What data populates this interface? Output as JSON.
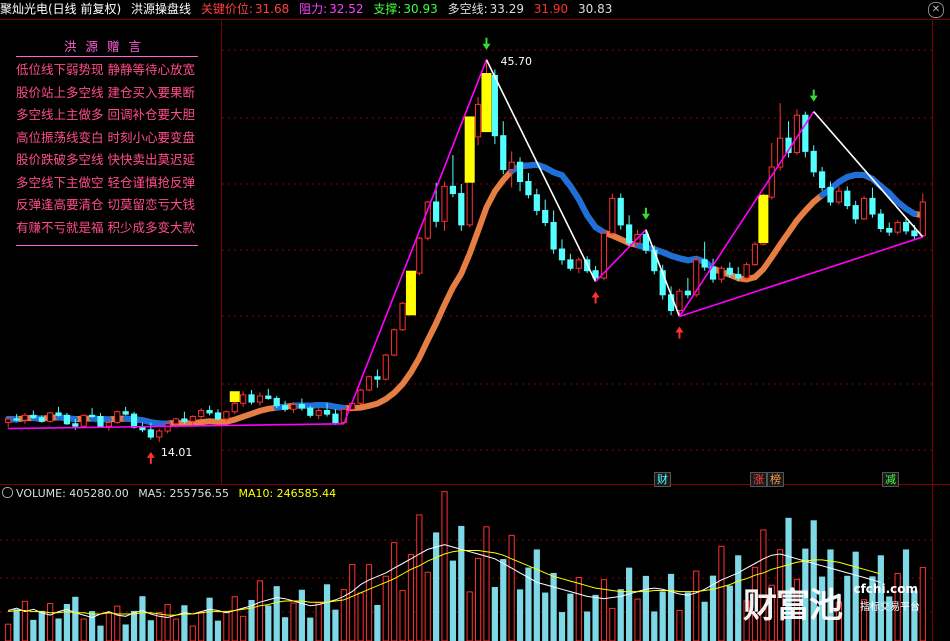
{
  "header": {
    "stock": "聚灿光电(日线 前复权)",
    "indicator": "洪源操盘线",
    "key_label": "关键价位:",
    "key_value": "31.68",
    "resist_label": "阻力:",
    "resist_value": "32.52",
    "support_label": "支撑:",
    "support_value": "30.93",
    "multi_label": "多空线:",
    "multi_value": "33.29",
    "v1": "31.90",
    "v2": "30.83"
  },
  "panel": {
    "title": "洪源赠言",
    "lines": [
      "低位线下弱势现 静静等待心放宽",
      "股价站上多空线 建仓买入要果断",
      "多空线上主做多 回调补仓要大胆",
      "高位振荡线变白 时刻小心要变盘",
      "股价跌破多空线 快快卖出莫迟延",
      "多空线下主做空 轻仓谨慎抢反弹",
      "反弹逢高要清仓 切莫留恋亏大钱",
      "有赚不亏就是福 积少成多变大款"
    ]
  },
  "volume_header": {
    "label": "VOLUME: 405280.00",
    "ma5": "MA5: 255756.55",
    "ma10": "MA10: 246585.44"
  },
  "tags": [
    "财",
    "涨",
    "榜",
    "减"
  ],
  "watermark": {
    "brand": "财富池",
    "url": "cfchi.com",
    "sub": "指标交易平台"
  },
  "colors": {
    "up": "#ff3030",
    "down": "#54ffff",
    "yellow": "#ffff00",
    "magenta": "#ff00ff",
    "orange": "#ff8c4a",
    "blue": "#1e6fd9"
  },
  "chart_data": {
    "type": "candlestick",
    "annotations": {
      "high": "45.70",
      "low": "14.01"
    },
    "price_range": [
      11,
      49
    ],
    "candles": [
      [
        15.6,
        16.1,
        15.2,
        15.9
      ],
      [
        15.9,
        16.3,
        15.7,
        15.8
      ],
      [
        15.8,
        16.4,
        15.5,
        16.2
      ],
      [
        16.2,
        16.6,
        15.9,
        16.0
      ],
      [
        16.0,
        16.2,
        15.6,
        15.7
      ],
      [
        15.7,
        16.5,
        15.6,
        16.4
      ],
      [
        16.4,
        16.9,
        16.1,
        16.2
      ],
      [
        16.2,
        16.4,
        15.4,
        15.5
      ],
      [
        15.5,
        15.9,
        15.0,
        15.3
      ],
      [
        15.3,
        16.3,
        15.2,
        16.2
      ],
      [
        16.2,
        16.8,
        16.0,
        16.1
      ],
      [
        16.1,
        16.4,
        15.2,
        15.3
      ],
      [
        15.3,
        15.8,
        14.9,
        15.6
      ],
      [
        15.6,
        16.6,
        15.5,
        16.5
      ],
      [
        16.5,
        16.9,
        16.2,
        16.3
      ],
      [
        16.3,
        16.5,
        15.1,
        15.2
      ],
      [
        15.2,
        15.6,
        14.8,
        15.0
      ],
      [
        15.0,
        15.6,
        14.2,
        14.4
      ],
      [
        14.4,
        15.1,
        14.0,
        14.9
      ],
      [
        14.9,
        15.7,
        14.7,
        15.5
      ],
      [
        15.5,
        16.0,
        15.2,
        15.9
      ],
      [
        15.9,
        16.5,
        15.5,
        15.7
      ],
      [
        15.7,
        16.2,
        15.3,
        16.1
      ],
      [
        16.1,
        16.8,
        15.9,
        16.6
      ],
      [
        16.6,
        17.0,
        16.2,
        16.4
      ],
      [
        16.4,
        16.7,
        15.8,
        15.9
      ],
      [
        15.9,
        16.6,
        15.7,
        16.5
      ],
      [
        16.5,
        17.4,
        16.3,
        17.2
      ],
      [
        17.2,
        18.2,
        16.9,
        17.9
      ],
      [
        17.9,
        18.3,
        17.1,
        17.3
      ],
      [
        17.3,
        18.1,
        17.0,
        17.8
      ],
      [
        17.8,
        18.4,
        17.5,
        17.6
      ],
      [
        17.6,
        17.8,
        16.8,
        17.0
      ],
      [
        17.0,
        17.4,
        16.5,
        16.7
      ],
      [
        16.7,
        17.3,
        16.4,
        17.1
      ],
      [
        17.1,
        17.6,
        16.6,
        16.8
      ],
      [
        16.8,
        17.0,
        16.0,
        16.2
      ],
      [
        16.2,
        16.8,
        15.9,
        16.6
      ],
      [
        16.6,
        17.2,
        16.1,
        16.3
      ],
      [
        16.3,
        16.7,
        15.4,
        15.6
      ],
      [
        15.6,
        16.8,
        15.5,
        16.7
      ],
      [
        16.7,
        17.3,
        16.6,
        17.2
      ],
      [
        17.2,
        18.4,
        17.1,
        18.3
      ],
      [
        18.3,
        19.5,
        18.2,
        19.4
      ],
      [
        19.4,
        20.0,
        18.5,
        19.2
      ],
      [
        19.2,
        21.3,
        19.1,
        21.2
      ],
      [
        21.2,
        23.4,
        21.1,
        23.3
      ],
      [
        23.3,
        25.6,
        23.2,
        25.5
      ],
      [
        25.5,
        28.1,
        25.4,
        28.0
      ],
      [
        28.0,
        31.0,
        27.8,
        30.9
      ],
      [
        30.9,
        34.0,
        30.7,
        33.9
      ],
      [
        33.9,
        35.5,
        31.8,
        32.3
      ],
      [
        32.3,
        35.6,
        31.5,
        35.2
      ],
      [
        35.2,
        37.8,
        34.3,
        34.6
      ],
      [
        34.6,
        35.4,
        31.5,
        32.0
      ],
      [
        32.0,
        39.6,
        31.8,
        39.3
      ],
      [
        39.3,
        42.6,
        38.6,
        42.0
      ],
      [
        42.0,
        45.7,
        41.6,
        44.4
      ],
      [
        44.4,
        44.9,
        38.7,
        39.4
      ],
      [
        39.4,
        40.6,
        36.2,
        36.6
      ],
      [
        36.6,
        38.1,
        35.1,
        37.2
      ],
      [
        37.2,
        37.6,
        34.8,
        35.6
      ],
      [
        35.6,
        36.3,
        34.2,
        34.5
      ],
      [
        34.5,
        35.0,
        32.8,
        33.2
      ],
      [
        33.2,
        34.1,
        31.9,
        32.2
      ],
      [
        32.2,
        33.2,
        29.6,
        30.0
      ],
      [
        30.0,
        30.8,
        28.7,
        29.1
      ],
      [
        29.1,
        29.6,
        28.2,
        28.4
      ],
      [
        28.4,
        29.3,
        28.0,
        29.1
      ],
      [
        29.1,
        29.4,
        28.0,
        28.2
      ],
      [
        28.2,
        28.6,
        27.3,
        27.6
      ],
      [
        27.6,
        31.6,
        27.4,
        31.3
      ],
      [
        31.3,
        34.6,
        31.1,
        34.2
      ],
      [
        34.2,
        34.6,
        31.6,
        32.0
      ],
      [
        32.0,
        32.8,
        30.1,
        30.5
      ],
      [
        30.5,
        31.6,
        30.2,
        31.2
      ],
      [
        31.2,
        31.5,
        29.6,
        29.9
      ],
      [
        29.9,
        30.3,
        27.9,
        28.2
      ],
      [
        28.2,
        28.7,
        25.8,
        26.2
      ],
      [
        26.2,
        26.9,
        24.5,
        24.9
      ],
      [
        24.9,
        26.7,
        24.4,
        26.5
      ],
      [
        26.5,
        27.6,
        25.9,
        26.2
      ],
      [
        26.2,
        29.4,
        26.0,
        29.1
      ],
      [
        29.1,
        30.6,
        28.2,
        28.5
      ],
      [
        28.5,
        29.2,
        27.2,
        27.5
      ],
      [
        27.5,
        28.6,
        27.2,
        28.4
      ],
      [
        28.4,
        28.9,
        27.6,
        27.9
      ],
      [
        27.9,
        28.5,
        27.3,
        27.6
      ],
      [
        27.6,
        28.9,
        27.4,
        28.7
      ],
      [
        28.7,
        30.6,
        28.6,
        30.4
      ],
      [
        30.4,
        34.6,
        30.3,
        34.3
      ],
      [
        34.3,
        38.8,
        34.1,
        36.8
      ],
      [
        36.8,
        42.1,
        36.5,
        39.2
      ],
      [
        39.2,
        40.6,
        37.6,
        38.0
      ],
      [
        38.0,
        41.6,
        37.8,
        41.1
      ],
      [
        41.1,
        41.4,
        37.6,
        38.1
      ],
      [
        38.1,
        38.6,
        36.0,
        36.4
      ],
      [
        36.4,
        36.8,
        34.8,
        35.1
      ],
      [
        35.1,
        35.6,
        33.6,
        33.9
      ],
      [
        33.9,
        35.2,
        33.7,
        34.8
      ],
      [
        34.8,
        35.2,
        33.3,
        33.6
      ],
      [
        33.6,
        34.0,
        32.1,
        32.5
      ],
      [
        32.5,
        34.4,
        32.4,
        34.2
      ],
      [
        34.2,
        35.1,
        32.6,
        32.9
      ],
      [
        32.9,
        33.3,
        31.4,
        31.7
      ],
      [
        31.7,
        32.2,
        31.1,
        31.4
      ],
      [
        31.4,
        32.4,
        31.2,
        32.2
      ],
      [
        32.2,
        32.6,
        31.2,
        31.5
      ],
      [
        31.5,
        32.0,
        30.8,
        31.1
      ],
      [
        31.1,
        34.6,
        30.9,
        33.9
      ]
    ],
    "volume_range": [
      0,
      120
    ],
    "volume_ma5": [
      26,
      28,
      25,
      27,
      24,
      22,
      25,
      27,
      24,
      22,
      20,
      23,
      25,
      22,
      21,
      24,
      26,
      23,
      21,
      20,
      22,
      24,
      23,
      25,
      27,
      26,
      24,
      26,
      28,
      30,
      33,
      35,
      37,
      36,
      34,
      32,
      30,
      31,
      33,
      35,
      38,
      42,
      48,
      52,
      55,
      58,
      62,
      66,
      70,
      74,
      78,
      80,
      82,
      80,
      78,
      76,
      74,
      72,
      70,
      66,
      62,
      58,
      54,
      50,
      48,
      46,
      44,
      42,
      40,
      38,
      37,
      36,
      37,
      38,
      40,
      42,
      44,
      45,
      44,
      42,
      40,
      39,
      41,
      44,
      48,
      52,
      55,
      58,
      62,
      66,
      70,
      73,
      74,
      72,
      70,
      68,
      66,
      64,
      62,
      60,
      58,
      56,
      54,
      52,
      50
    ],
    "volume_ma10": [
      25,
      26,
      26,
      25,
      25,
      24,
      24,
      25,
      24,
      24,
      23,
      23,
      24,
      23,
      23,
      23,
      24,
      24,
      23,
      22,
      22,
      23,
      23,
      24,
      25,
      25,
      25,
      26,
      27,
      28,
      30,
      31,
      33,
      34,
      34,
      34,
      33,
      33,
      33,
      34,
      35,
      38,
      41,
      44,
      47,
      50,
      53,
      57,
      61,
      64,
      68,
      71,
      74,
      76,
      77,
      77,
      77,
      76,
      75,
      73,
      70,
      67,
      64,
      61,
      58,
      55,
      53,
      51,
      49,
      47,
      45,
      44,
      43,
      42,
      42,
      42,
      42,
      43,
      43,
      43,
      42,
      42,
      42,
      43,
      44,
      46,
      48,
      51,
      53,
      56,
      58,
      61,
      63,
      65,
      67,
      68,
      69,
      69,
      68,
      67,
      65,
      63,
      61,
      59,
      57
    ],
    "volume_ma10_tail": [],
    "tags_pos": []
  }
}
